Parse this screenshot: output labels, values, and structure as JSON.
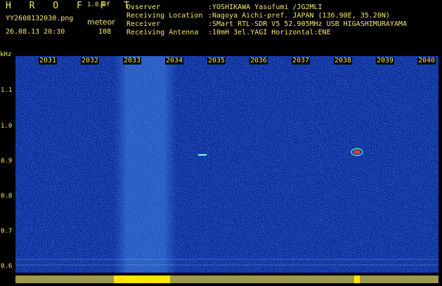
{
  "header": {
    "brand": "H R O F F T",
    "version": "1.0.0f",
    "filename": "YY2608132030.png",
    "datetime": "26.08.13 20:30",
    "mode": "meteor",
    "count": "108",
    "rows": [
      {
        "label": "Ovserver",
        "value": ":YOSHIKAWA Yasufumi /JG2MLI"
      },
      {
        "label": "Receiving Location",
        "value": ":Nagoya Aichi-pref. JAPAN (136.90E, 35.20N)"
      },
      {
        "label": "Receiver",
        "value": ":SMart RTL-SDR V5 52.905MHz USB HIGASHIMURAYAMA"
      },
      {
        "label": "Receiving Antenna",
        "value": ":10mH 3el.YAGI Horizontal:ENE"
      }
    ]
  },
  "axis": {
    "unit": "kHz",
    "y_ticks": [
      "1.1",
      "1.0",
      "0.9",
      "0.8",
      "0.7",
      "0.6"
    ],
    "x_ticks": [
      "2031",
      "2032",
      "2033",
      "2034",
      "2035",
      "2036",
      "2037",
      "2038",
      "2039",
      "2040"
    ]
  },
  "colors": {
    "background": "#0a2a9a",
    "label": "#f5e86a",
    "echo": "#ff3030"
  }
}
